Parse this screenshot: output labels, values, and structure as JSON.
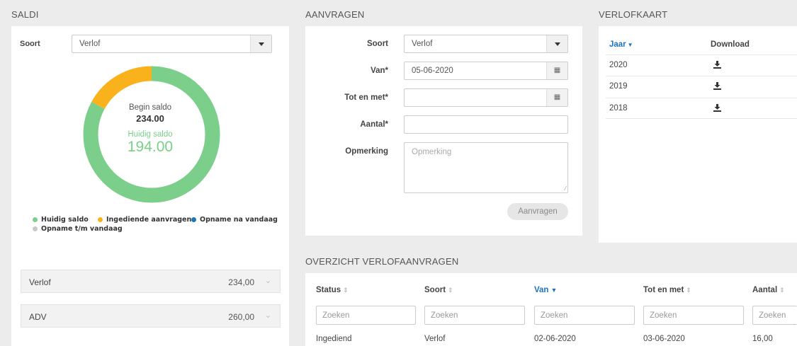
{
  "saldi": {
    "title": "SALDI",
    "soort_label": "Soort",
    "soort_value": "Verlof",
    "donut": {
      "begin_label": "Begin saldo",
      "begin_value": "234.00",
      "huidig_label": "Huidig saldo",
      "huidig_value": "194.00",
      "fraction_huidig": 0.829,
      "fraction_ingediend": 0.171,
      "color_huidig": "#7ccf8a",
      "color_ingediend": "#f9b21b"
    },
    "legend": [
      {
        "label": "Huidig saldo",
        "color": "#7ccf8a"
      },
      {
        "label": "Ingediende aanvragen",
        "color": "#f9b21b"
      },
      {
        "label": "Opname na vandaag",
        "color": "#1a77b8"
      },
      {
        "label": "Opname t/m vandaag",
        "color": "#c8c8c8"
      }
    ],
    "accordion": [
      {
        "label": "Verlof",
        "value": "234,00"
      },
      {
        "label": "ADV",
        "value": "260,00"
      }
    ]
  },
  "aanvragen": {
    "title": "AANVRAGEN",
    "soort_label": "Soort",
    "soort_value": "Verlof",
    "van_label": "Van*",
    "van_value": "05-06-2020",
    "tot_label": "Tot en met*",
    "tot_value": "",
    "aantal_label": "Aantal*",
    "aantal_value": "",
    "opmerking_label": "Opmerking",
    "opmerking_placeholder": "Opmerking",
    "submit_label": "Aanvragen"
  },
  "verlofkaart": {
    "title": "VERLOFKAART",
    "col_jaar": "Jaar",
    "col_download": "Download",
    "rows": [
      {
        "jaar": "2020"
      },
      {
        "jaar": "2019"
      },
      {
        "jaar": "2018"
      }
    ],
    "accent": "#1e73be"
  },
  "overzicht": {
    "title": "OVERZICHT VERLOFAANVRAGEN",
    "columns": [
      "Status",
      "Soort",
      "Van",
      "Tot en met",
      "Aantal"
    ],
    "search_placeholder": "Zoeken",
    "rows": [
      [
        "Ingediend",
        "Verlof",
        "02-06-2020",
        "03-06-2020",
        "16,00"
      ]
    ]
  }
}
